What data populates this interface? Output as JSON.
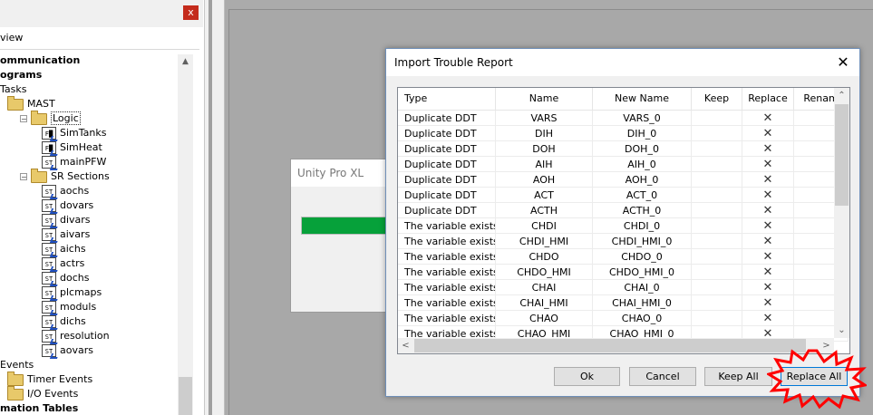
{
  "left_panel": {
    "close_glyph": "x",
    "view_label": "view",
    "tree": [
      {
        "label": "ommunication",
        "bold": true,
        "indent": 0,
        "icon": "none"
      },
      {
        "label": "ograms",
        "bold": true,
        "indent": 0,
        "icon": "none"
      },
      {
        "label": "Tasks",
        "bold": false,
        "indent": 1,
        "icon": "none"
      },
      {
        "label": "MAST",
        "bold": false,
        "indent": 2,
        "icon": "folder-icon"
      },
      {
        "label": "Logic",
        "bold": false,
        "indent": 3,
        "icon": "folder-icon",
        "expander": "−",
        "selected": true
      },
      {
        "label": "SimTanks",
        "bold": false,
        "indent": 4,
        "icon": "fbd-section-icon"
      },
      {
        "label": "SimHeat",
        "bold": false,
        "indent": 4,
        "icon": "fbd-section-icon"
      },
      {
        "label": "mainPFW",
        "bold": false,
        "indent": 4,
        "icon": "st-section-icon"
      },
      {
        "label": "SR Sections",
        "bold": false,
        "indent": 3,
        "icon": "folder-icon",
        "expander": "−"
      },
      {
        "label": "aochs",
        "bold": false,
        "indent": 4,
        "icon": "st-section-icon"
      },
      {
        "label": "dovars",
        "bold": false,
        "indent": 4,
        "icon": "st-section-icon"
      },
      {
        "label": "divars",
        "bold": false,
        "indent": 4,
        "icon": "st-section-icon"
      },
      {
        "label": "aivars",
        "bold": false,
        "indent": 4,
        "icon": "st-section-icon"
      },
      {
        "label": "aichs",
        "bold": false,
        "indent": 4,
        "icon": "st-section-icon"
      },
      {
        "label": "actrs",
        "bold": false,
        "indent": 4,
        "icon": "st-section-icon"
      },
      {
        "label": "dochs",
        "bold": false,
        "indent": 4,
        "icon": "st-section-icon"
      },
      {
        "label": "plcmaps",
        "bold": false,
        "indent": 4,
        "icon": "st-section-icon"
      },
      {
        "label": "moduls",
        "bold": false,
        "indent": 4,
        "icon": "st-section-icon"
      },
      {
        "label": "dichs",
        "bold": false,
        "indent": 4,
        "icon": "st-section-icon"
      },
      {
        "label": "resolution",
        "bold": false,
        "indent": 4,
        "icon": "st-section-icon"
      },
      {
        "label": "aovars",
        "bold": false,
        "indent": 4,
        "icon": "st-section-icon"
      },
      {
        "label": "Events",
        "bold": false,
        "indent": 1,
        "icon": "none"
      },
      {
        "label": "Timer Events",
        "bold": false,
        "indent": 2,
        "icon": "folder-icon"
      },
      {
        "label": "I/O Events",
        "bold": false,
        "indent": 2,
        "icon": "folder-icon"
      },
      {
        "label": "mation Tables",
        "bold": true,
        "indent": 0,
        "icon": "none"
      }
    ]
  },
  "unity_window": {
    "title": "Unity Pro XL",
    "progress": 1.0,
    "progress_color": "#06a13a"
  },
  "dialog": {
    "title": "Import Trouble Report",
    "close_glyph": "✕",
    "columns": [
      "Type",
      "Name",
      "New Name",
      "Keep",
      "Replace",
      "Renam"
    ],
    "rows": [
      {
        "type": "Duplicate DDT",
        "name": "VARS",
        "new_name": "VARS_0",
        "keep": "",
        "replace": "✕",
        "rename": ""
      },
      {
        "type": "Duplicate DDT",
        "name": "DIH",
        "new_name": "DIH_0",
        "keep": "",
        "replace": "✕",
        "rename": ""
      },
      {
        "type": "Duplicate DDT",
        "name": "DOH",
        "new_name": "DOH_0",
        "keep": "",
        "replace": "✕",
        "rename": ""
      },
      {
        "type": "Duplicate DDT",
        "name": "AIH",
        "new_name": "AIH_0",
        "keep": "",
        "replace": "✕",
        "rename": ""
      },
      {
        "type": "Duplicate DDT",
        "name": "AOH",
        "new_name": "AOH_0",
        "keep": "",
        "replace": "✕",
        "rename": ""
      },
      {
        "type": "Duplicate DDT",
        "name": "ACT",
        "new_name": "ACT_0",
        "keep": "",
        "replace": "✕",
        "rename": ""
      },
      {
        "type": "Duplicate DDT",
        "name": "ACTH",
        "new_name": "ACTH_0",
        "keep": "",
        "replace": "✕",
        "rename": ""
      },
      {
        "type": "The variable exists...",
        "name": "CHDI",
        "new_name": "CHDI_0",
        "keep": "",
        "replace": "✕",
        "rename": ""
      },
      {
        "type": "The variable exists...",
        "name": "CHDI_HMI",
        "new_name": "CHDI_HMI_0",
        "keep": "",
        "replace": "✕",
        "rename": ""
      },
      {
        "type": "The variable exists...",
        "name": "CHDO",
        "new_name": "CHDO_0",
        "keep": "",
        "replace": "✕",
        "rename": ""
      },
      {
        "type": "The variable exists...",
        "name": "CHDO_HMI",
        "new_name": "CHDO_HMI_0",
        "keep": "",
        "replace": "✕",
        "rename": ""
      },
      {
        "type": "The variable exists...",
        "name": "CHAI",
        "new_name": "CHAI_0",
        "keep": "",
        "replace": "✕",
        "rename": ""
      },
      {
        "type": "The variable exists...",
        "name": "CHAI_HMI",
        "new_name": "CHAI_HMI_0",
        "keep": "",
        "replace": "✕",
        "rename": ""
      },
      {
        "type": "The variable exists...",
        "name": "CHAO",
        "new_name": "CHAO_0",
        "keep": "",
        "replace": "✕",
        "rename": ""
      },
      {
        "type": "The variable exists...",
        "name": "CHAO_HMI",
        "new_name": "CHAO_HMI_0",
        "keep": "",
        "replace": "✕",
        "rename": ""
      }
    ],
    "buttons": {
      "ok": "Ok",
      "cancel": "Cancel",
      "keep_all": "Keep All",
      "replace_all": "Replace All"
    },
    "scroll": {
      "up": "⌃",
      "down": "⌄",
      "left": "<",
      "right": ">"
    }
  },
  "colors": {
    "highlight_burst": "#ff0000",
    "accent_border": "#0078d7"
  }
}
